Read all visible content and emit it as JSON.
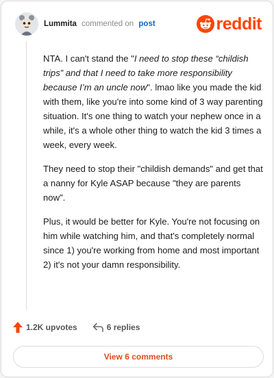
{
  "header": {
    "username": "Lummita",
    "action_text": "commented on",
    "target": "post",
    "brand": "reddit"
  },
  "comment": {
    "p1_part1": "NTA. I can't stand the \"",
    "p1_quote": "I need to stop these “childish trips” and that I need to take more responsibility because I’m an uncle now",
    "p1_part2": "\". lmao like you made the kid with them, like you're into some kind of 3 way parenting situation. It's one thing to watch your nephew once in a while, it's a whole other thing to watch the kid 3 times a week, every week.",
    "p2": "They need to stop their \"childish demands\" and get that a nanny for Kyle ASAP because \"they are parents now\".",
    "p3": "Plus, it would be better for Kyle. You're not focusing on him while watching him, and that's completely normal since 1) you're working from home and most important 2) it's not your damn responsibility."
  },
  "actions": {
    "upvotes": "1.2K upvotes",
    "replies": "6 replies",
    "view_comments": "View 6 comments"
  },
  "colors": {
    "brand": "#ff4500",
    "link": "#1565c0",
    "view_button_text": "#e04b1a"
  },
  "icons": {
    "avatar": "user-avatar",
    "logo": "reddit-snoo-icon",
    "upvote": "upvote-arrow-icon",
    "reply": "reply-arrow-icon"
  }
}
